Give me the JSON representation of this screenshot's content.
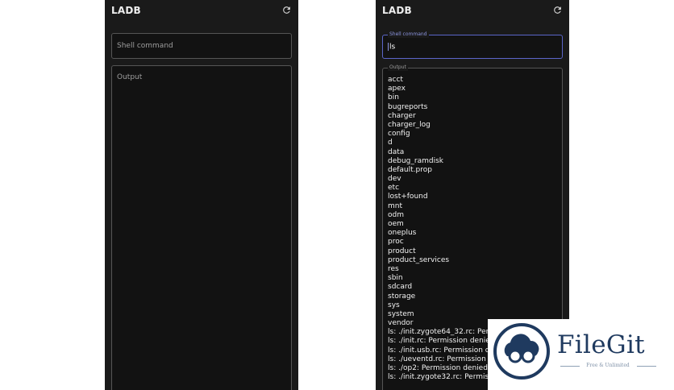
{
  "screens": [
    {
      "app_title": "LADB",
      "refresh_icon": "refresh-icon",
      "command_field": {
        "placeholder": "Shell command"
      },
      "output_field": {
        "placeholder": "Output"
      }
    },
    {
      "app_title": "LADB",
      "refresh_icon": "refresh-icon",
      "command_field": {
        "label": "Shell command",
        "value": "ls"
      },
      "output_field": {
        "label": "Output",
        "lines": [
          "acct",
          "apex",
          "bin",
          "bugreports",
          "charger",
          "charger_log",
          "config",
          "d",
          "data",
          "debug_ramdisk",
          "default.prop",
          "dev",
          "etc",
          "lost+found",
          "mnt",
          "odm",
          "oem",
          "oneplus",
          "proc",
          "product",
          "product_services",
          "res",
          "sbin",
          "sdcard",
          "storage",
          "sys",
          "system",
          "vendor",
          "ls: ./init.zygote64_32.rc: Permission denied",
          "ls: ./init.rc: Permission denied",
          "ls: ./init.usb.rc: Permission denied",
          "ls: ./ueventd.rc: Permission denied",
          "ls: ./op2: Permission denied",
          "ls: ./init.zygote32.rc: Permission denied"
        ]
      }
    }
  ],
  "watermark": {
    "name": "FileGit",
    "tagline": "Free & Unlimited",
    "logo_icon": "filegit-logo-icon"
  },
  "colors": {
    "phone_background": "#1a1a1a",
    "field_background": "#121212",
    "focus_accent": "#5b66c9",
    "watermark_text": "#1f3a5f"
  }
}
